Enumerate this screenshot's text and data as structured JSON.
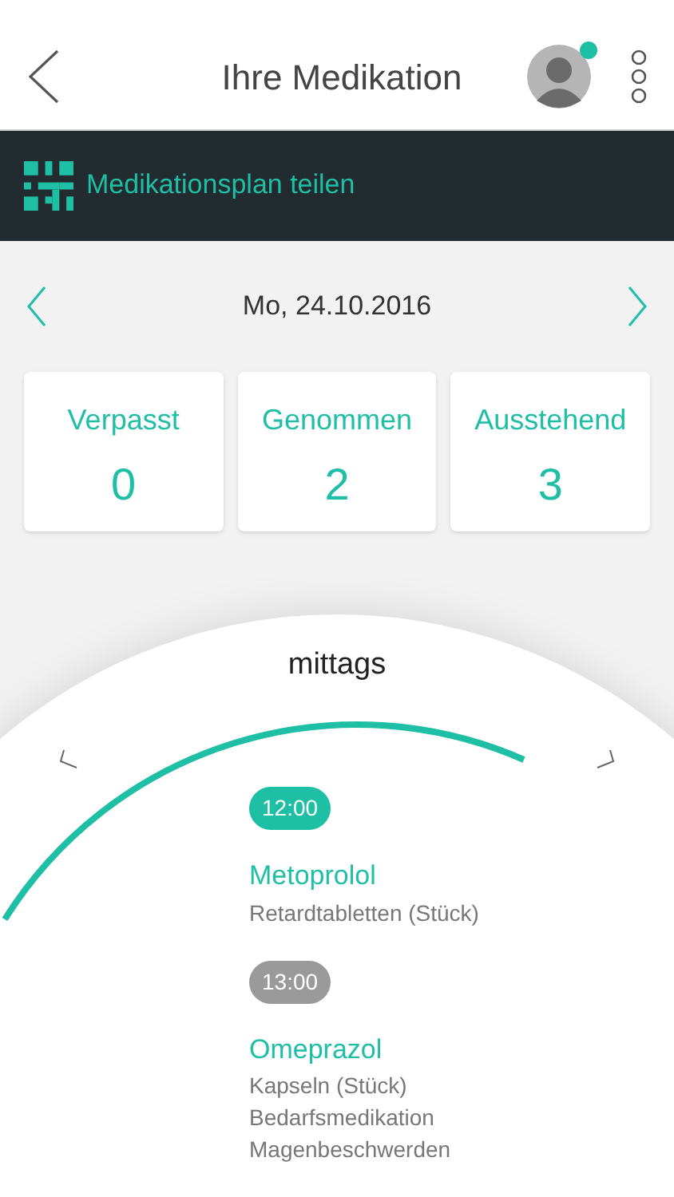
{
  "header": {
    "title": "Ihre Medikation",
    "avatar_online": true
  },
  "share_bar": {
    "label": "Medikationsplan teilen"
  },
  "date": "Mo, 24.10.2016",
  "stats": [
    {
      "label": "Verpasst",
      "value": "0"
    },
    {
      "label": "Genommen",
      "value": "2"
    },
    {
      "label": "Ausstehend",
      "value": "3"
    }
  ],
  "dial": {
    "period": "mittags",
    "doses": [
      {
        "time": "12:00",
        "taken": true,
        "name": "Metoprolol",
        "details": [
          "Retardtabletten (Stück)"
        ]
      },
      {
        "time": "13:00",
        "taken": false,
        "name": "Omeprazol",
        "details": [
          "Kapseln (Stück)",
          "Bedarfsmedikation",
          "Magenbeschwerden"
        ]
      }
    ]
  }
}
